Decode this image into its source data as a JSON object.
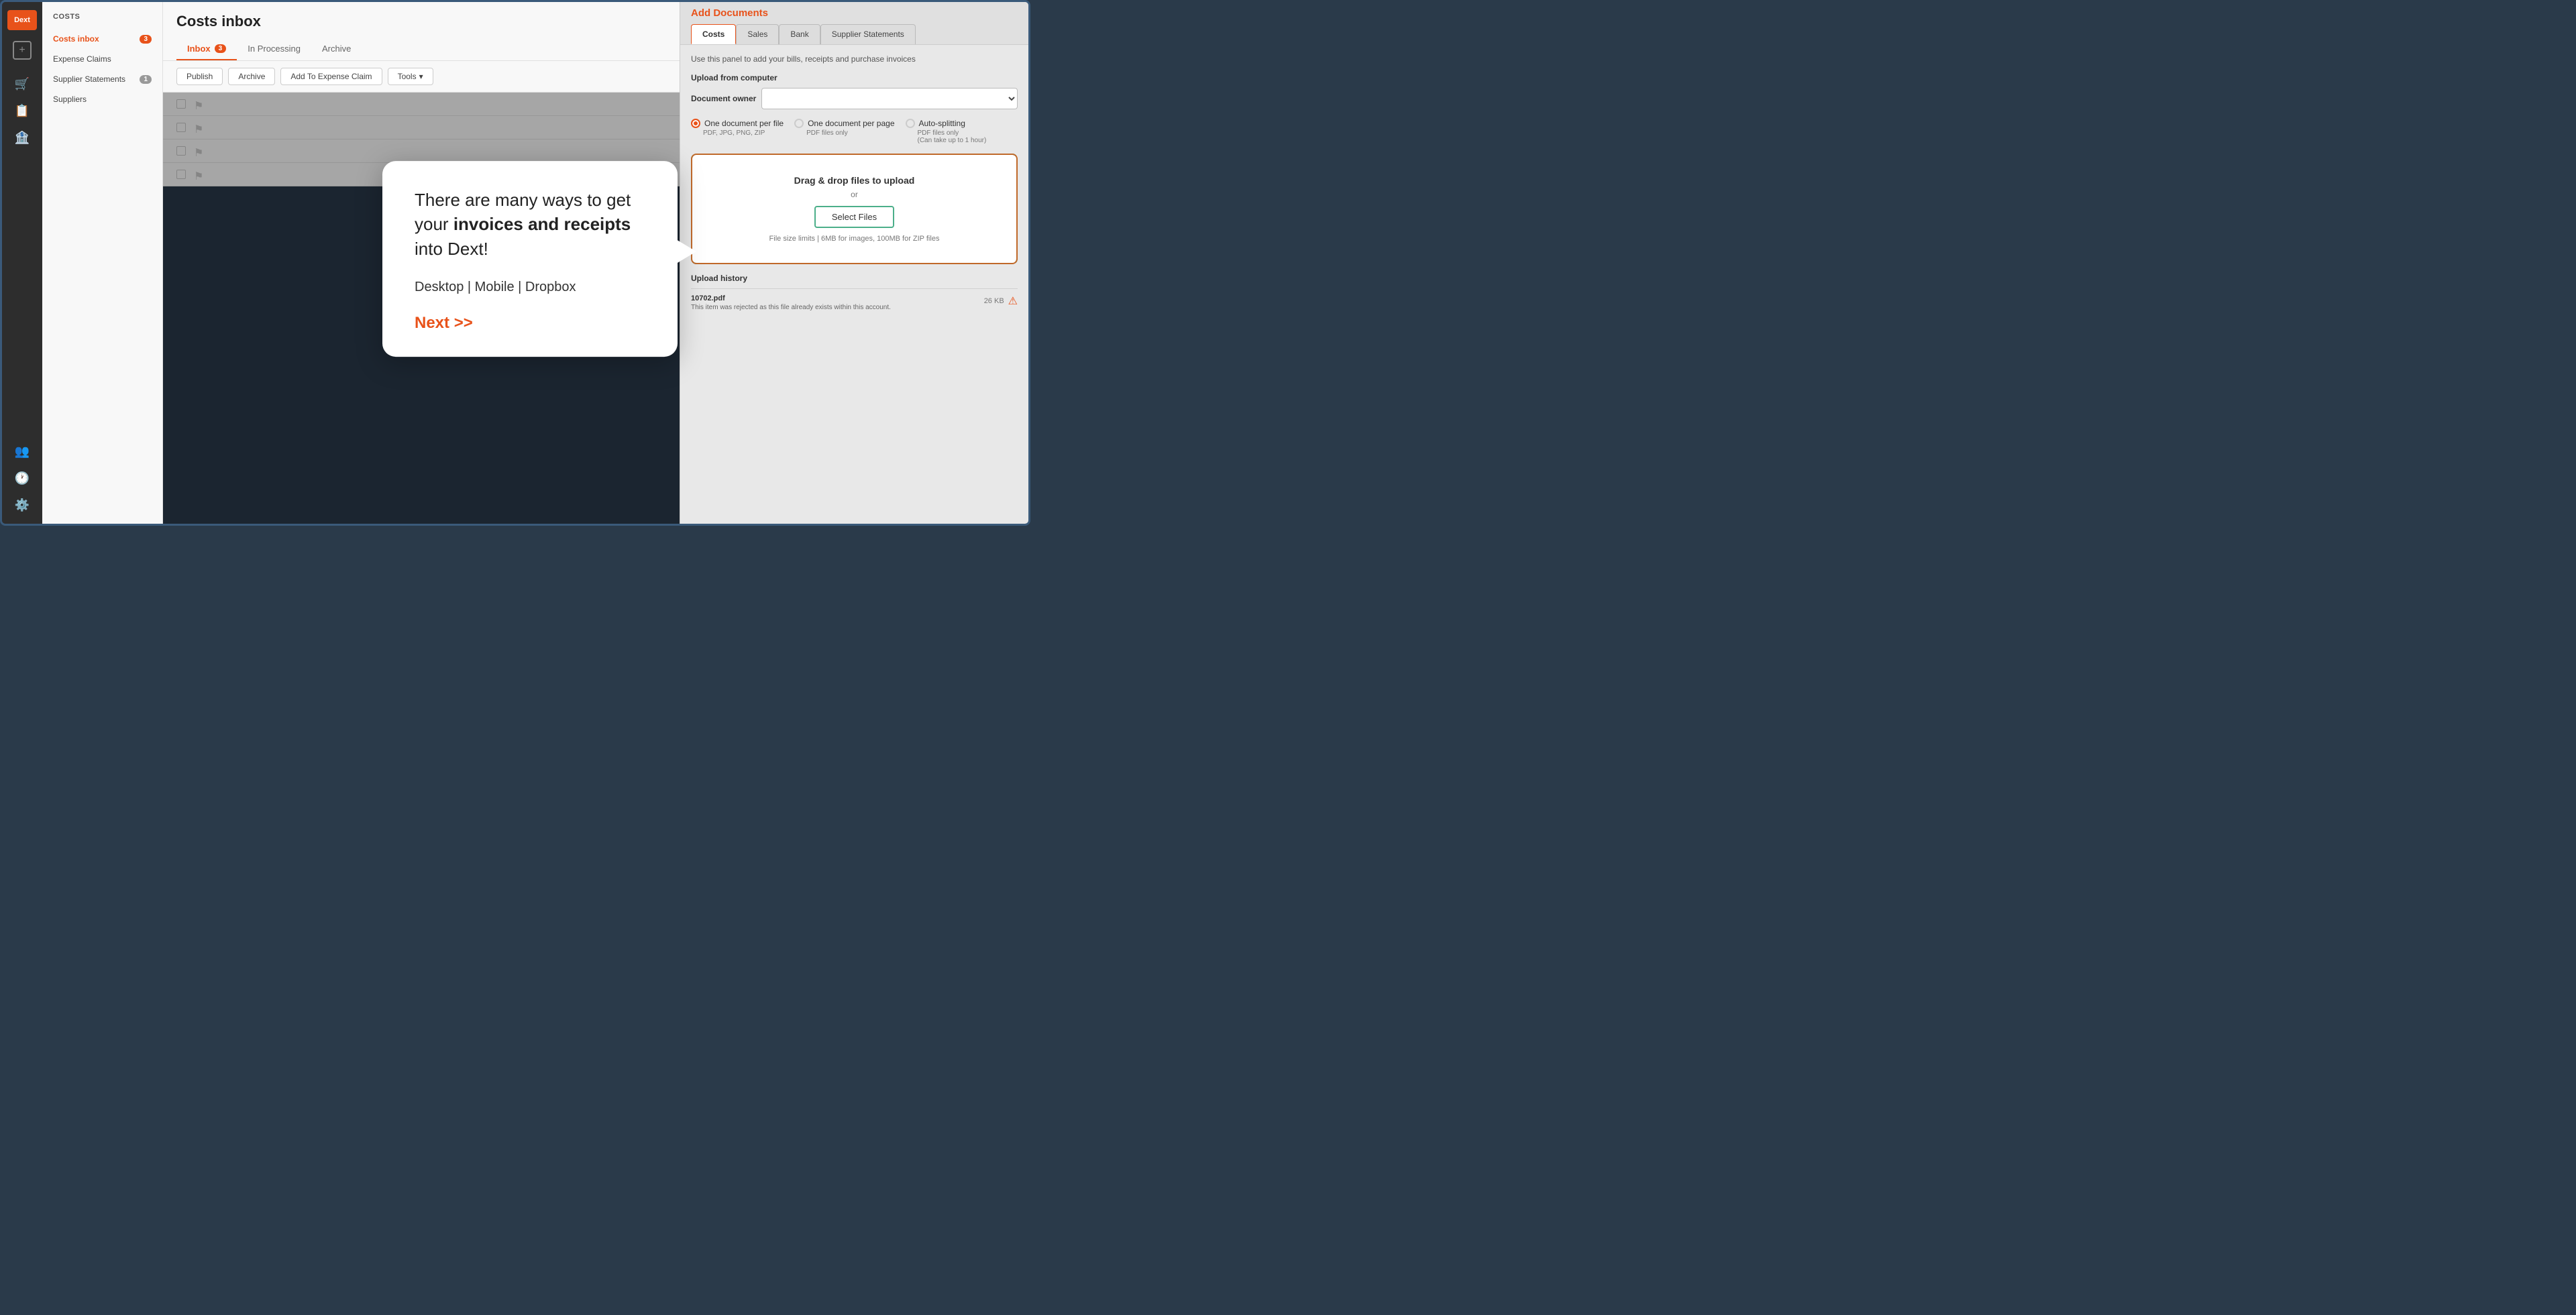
{
  "app": {
    "title": "Dext"
  },
  "nav": {
    "logo": "Dext",
    "add_btn": "+",
    "icons": [
      "🛒",
      "📋",
      "🏦"
    ]
  },
  "sub_sidebar": {
    "title": "COSTS",
    "items": [
      {
        "label": "Costs inbox",
        "badge": "3",
        "active": true
      },
      {
        "label": "Expense Claims",
        "badge": null
      },
      {
        "label": "Supplier Statements",
        "badge": "1"
      },
      {
        "label": "Suppliers",
        "badge": null
      }
    ]
  },
  "content": {
    "title": "Costs inbox",
    "tabs": [
      {
        "label": "Inbox",
        "badge": "3",
        "active": true
      },
      {
        "label": "In Processing",
        "badge": null
      },
      {
        "label": "Archive",
        "badge": null
      }
    ],
    "toolbar": {
      "publish": "Publish",
      "archive": "Archive",
      "add_to_expense": "Add To Expense Claim",
      "tools": "Tools"
    }
  },
  "right_panel": {
    "title": "Add Documents",
    "tabs": [
      {
        "label": "Costs",
        "active": true
      },
      {
        "label": "Sales"
      },
      {
        "label": "Bank"
      },
      {
        "label": "Supplier Statements"
      }
    ],
    "description": "Use this panel to add your bills, receipts and purchase invoices",
    "upload_from": "Upload from computer",
    "doc_owner_label": "Document owner",
    "radio_options": [
      {
        "label": "One document per file",
        "sub": "PDF, JPG, PNG, ZIP",
        "active": true
      },
      {
        "label": "One document per page",
        "sub": "PDF files only",
        "active": false
      },
      {
        "label": "Auto-splitting",
        "sub": "PDF files only\n(Can take up to 1 hour)",
        "active": false
      }
    ],
    "drop_zone": {
      "title": "Drag & drop files to upload",
      "or": "or",
      "select_files": "Select Files",
      "limits": "File size limits  |  6MB for images, 100MB for ZIP files"
    },
    "upload_history": {
      "title": "Upload history",
      "items": [
        {
          "name": "10702.pdf",
          "description": "This item was rejected as this file already exists within this account.",
          "size": "26 KB",
          "status": "error"
        }
      ]
    }
  },
  "tooltip": {
    "text_part1": "There are many ways to get your ",
    "text_bold": "invoices and receipts",
    "text_part2": " into Dext!",
    "methods": "Desktop | Mobile | Dropbox",
    "next": "Next >>"
  }
}
